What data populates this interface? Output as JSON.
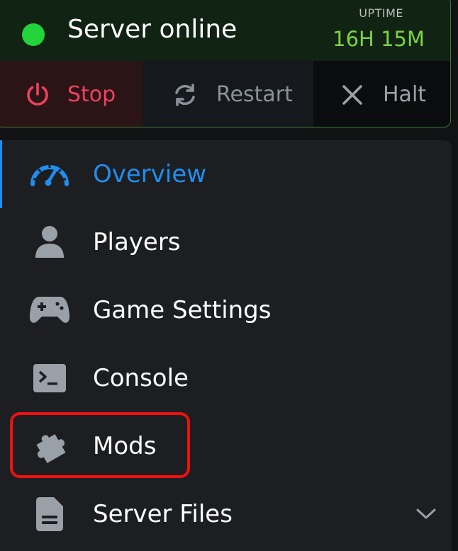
{
  "status": {
    "text": "Server online",
    "dot_color": "#22d33a",
    "uptime_label": "UPTIME",
    "uptime_value": "16H 15M"
  },
  "power": {
    "stop": {
      "label": "Stop",
      "icon": "power-icon",
      "color": "#f1405d"
    },
    "restart": {
      "label": "Restart",
      "icon": "restart-icon"
    },
    "halt": {
      "label": "Halt",
      "icon": "close-icon"
    }
  },
  "nav": {
    "items": [
      {
        "label": "Overview",
        "icon": "speedometer-icon",
        "active": true
      },
      {
        "label": "Players",
        "icon": "user-icon"
      },
      {
        "label": "Game Settings",
        "icon": "gamepad-icon"
      },
      {
        "label": "Console",
        "icon": "terminal-icon"
      },
      {
        "label": "Mods",
        "icon": "puzzle-icon",
        "highlighted": true
      },
      {
        "label": "Server Files",
        "icon": "file-icon",
        "expandable": true
      }
    ],
    "accent_color": "#1e8ff0"
  }
}
